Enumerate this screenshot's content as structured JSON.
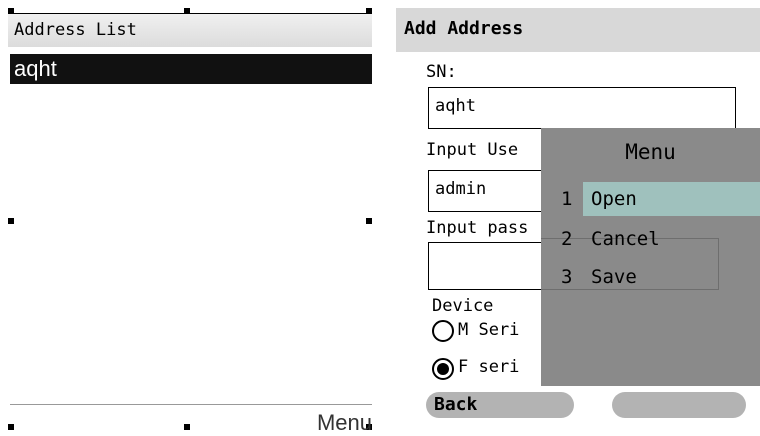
{
  "left_screen": {
    "title": "Address List",
    "list_items": [
      "aqht"
    ],
    "softkey_right": "Menu"
  },
  "right_screen": {
    "title": "Add Address",
    "sn_label": "SN:",
    "sn_value": "aqht",
    "user_label": "Input Use",
    "user_value": "admin",
    "pass_label": "Input pass",
    "pass_value": "",
    "device_label": "Device",
    "radio_options": [
      {
        "label": "M Seri",
        "selected": false
      },
      {
        "label": "F seri",
        "selected": true
      }
    ],
    "softkey_left": "Back",
    "softkey_right": ""
  },
  "menu": {
    "title": "Menu",
    "items": [
      {
        "num": "1",
        "label": "Open",
        "selected": true
      },
      {
        "num": "2",
        "label": "Cancel",
        "selected": false
      },
      {
        "num": "3",
        "label": "Save",
        "selected": false
      }
    ]
  },
  "colors": {
    "selection_highlight": "#9fc1bd",
    "menu_background": "#8a8a8a",
    "title_bar": "#d8d8d8",
    "list_selected": "#111111"
  }
}
